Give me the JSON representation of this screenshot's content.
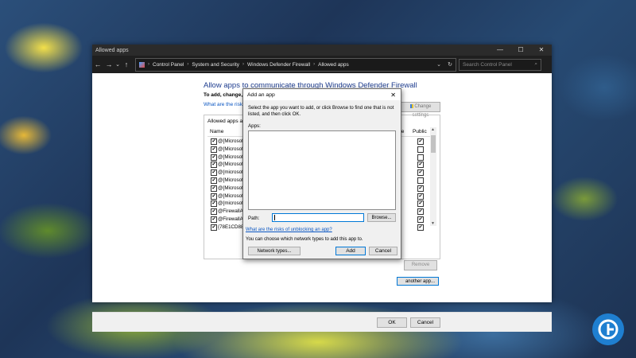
{
  "window": {
    "title": "Allowed apps",
    "controls": {
      "minimize": "—",
      "maximize": "☐",
      "close": "✕"
    }
  },
  "addressbar": {
    "back": "←",
    "forward": "→",
    "dropdown": "⌄",
    "up": "↑",
    "crumbs": [
      "Control Panel",
      "System and Security",
      "Windows Defender Firewall",
      "Allowed apps"
    ],
    "refresh": "↻",
    "search_placeholder": "Search Control Panel"
  },
  "main": {
    "heading": "Allow apps to communicate through Windows Defender Firewall",
    "subtext": "To add, change, or",
    "risk_link": "What are the risks",
    "change_settings": "Change settings",
    "panel_label": "Allowed apps and",
    "columns": {
      "name": "Name",
      "private": "te",
      "public": "Public"
    },
    "apps": [
      {
        "name": "@{Microsoft",
        "checked": true,
        "public": true
      },
      {
        "name": "@{Microsoft",
        "checked": true,
        "public": false
      },
      {
        "name": "@{Microsoft",
        "checked": true,
        "public": false
      },
      {
        "name": "@{Microsoft",
        "checked": true,
        "public": true
      },
      {
        "name": "@{microsoft",
        "checked": true,
        "public": true
      },
      {
        "name": "@{Microsoft",
        "checked": true,
        "public": false
      },
      {
        "name": "@{Microsoft",
        "checked": true,
        "public": true
      },
      {
        "name": "@{Microsoft",
        "checked": true,
        "public": true
      },
      {
        "name": "@{microsoft",
        "checked": true,
        "public": true
      },
      {
        "name": "@FirewallAP",
        "checked": true,
        "public": true
      },
      {
        "name": "@FirewallAP",
        "checked": true,
        "public": true
      },
      {
        "name": "{78E1CD88-",
        "checked": true,
        "public": true
      }
    ],
    "remove": "Remove",
    "allow_another": "another app...",
    "ok": "OK",
    "cancel": "Cancel"
  },
  "dialog": {
    "title": "Add an app",
    "close": "✕",
    "instructions": "Select the app you want to add, or click Browse to find one that is not listed, and then click OK.",
    "apps_label": "Apps:",
    "path_label": "Path:",
    "path_value": "",
    "browse": "Browse...",
    "risk_link": "What are the risks of unblocking an app?",
    "note": "You can choose which network types to add this app to.",
    "network_types": "Network types...",
    "add": "Add",
    "cancel": "Cancel"
  },
  "colors": {
    "accent": "#0078d7",
    "link": "#0a56c2",
    "heading": "#1e3d8f",
    "logo": "#1f7fd0"
  }
}
